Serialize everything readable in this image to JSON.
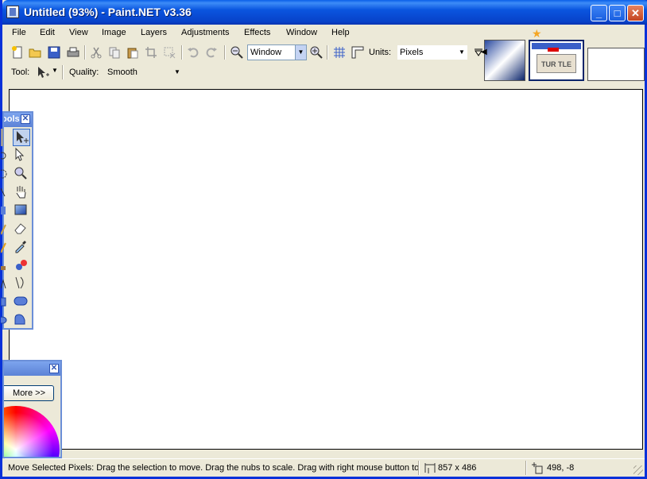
{
  "window": {
    "title": "Untitled (93%) - Paint.NET v3.36",
    "minimize": "_",
    "maximize": "□",
    "close": "✕"
  },
  "menu": [
    "File",
    "Edit",
    "View",
    "Image",
    "Layers",
    "Adjustments",
    "Effects",
    "Window",
    "Help"
  ],
  "toolbar": {
    "icons": [
      "new-icon",
      "open-icon",
      "save-icon",
      "print-icon",
      "cut-icon",
      "copy-icon",
      "paste-icon",
      "crop-icon",
      "deselect-icon",
      "undo-icon",
      "redo-icon",
      "zoom-out-icon",
      "zoom-in-icon",
      "grid-icon",
      "rulers-icon"
    ],
    "zoom_value": "Window",
    "units_label": "Units:",
    "units_value": "Pixels"
  },
  "tool_options": {
    "tool_label": "Tool:",
    "quality_label": "Quality:",
    "quality_value": "Smooth"
  },
  "thumbnails": {
    "star_color": "#f5a623",
    "plate_text": "TUR  TLE"
  },
  "tools_window": {
    "title": "ools",
    "close": "✕",
    "tools": [
      "move-selected-pixels-icon",
      "move-selection-icon",
      "zoom-icon",
      "pan-icon",
      "gradient-icon",
      "eraser-icon",
      "color-picker-icon",
      "recolor-icon",
      "line-curve-icon",
      "rounded-rectangle-icon",
      "freeform-shape-icon"
    ]
  },
  "colors_window": {
    "close": "✕",
    "more_label": "More >>"
  },
  "statusbar": {
    "hint": "Move Selected Pixels: Drag the selection to move. Drag the nubs to scale. Drag with right mouse button to r",
    "image_size": "857 x 486",
    "cursor_pos": "498, -8"
  },
  "colors": {
    "title_blue": "#0a55df",
    "panel_border": "#6b8fd8",
    "canvas": "#ffffff"
  }
}
